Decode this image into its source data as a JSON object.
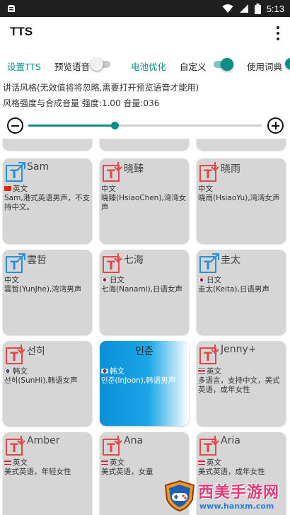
{
  "status_bar": {
    "time": "5:13",
    "icons": [
      "notification-icon",
      "wifi-icon",
      "signal-icon",
      "battery-icon"
    ]
  },
  "app_bar": {
    "title": "TTS",
    "menu_icon": "overflow-menu-icon"
  },
  "tabs": [
    {
      "label": "设置TTS",
      "active": true
    },
    {
      "label": "预览语音",
      "switch_on": false
    },
    {
      "label": "电池优化",
      "active": true
    },
    {
      "label": "自定义",
      "switch_on": true
    },
    {
      "label": "使用词典"
    }
  ],
  "info": {
    "speaking_style": "讲话风格(无效值将将忽略,需要打开预览语音才能用)",
    "style_strength": "风格强度与合成音量  强度:1.00 音量:036"
  },
  "slider": {
    "value_fraction": 0.37,
    "minus_icon": "minus-circle-icon",
    "plus_icon": "plus-circle-icon"
  },
  "colors": {
    "accent": "#0a8f86",
    "male_icon": "#2a8fd6",
    "female_icon": "#e04848",
    "selected_card": "#0a8fd6",
    "card_bg": "#d6d6d6"
  },
  "voices": [
    {
      "name": "",
      "gender": "female",
      "partial": true
    },
    {
      "name": "",
      "gender": "female",
      "partial": true
    },
    {
      "name": "",
      "gender": "female",
      "partial": true
    },
    {
      "name": "Sam",
      "gender": "male",
      "flag": "hk",
      "lang": "英文",
      "desc": "Sam,港式英语男声，不支持中文。"
    },
    {
      "name": "晓臻",
      "gender": "female",
      "lang": "中文",
      "desc": "晓臻(HsiaoChen),湾湾女声"
    },
    {
      "name": "晓雨",
      "gender": "female",
      "lang": "中文",
      "desc": "晓雨(HsiaoYu),湾湾女声"
    },
    {
      "name": "雲哲",
      "gender": "male",
      "lang": "中文",
      "desc": "雲哲(YunJhe),湾湾男声"
    },
    {
      "name": "七海",
      "gender": "female",
      "flag": "jp",
      "lang": "日文",
      "desc": "七海(Nanami),日语女声"
    },
    {
      "name": "圭太",
      "gender": "male",
      "flag": "jp",
      "lang": "日文",
      "desc": "圭太(Keita),日语男声"
    },
    {
      "name": "선히",
      "gender": "female",
      "flag": "kr",
      "lang": "韩文",
      "desc": "선히(SunHi),韩语女声"
    },
    {
      "name": "인준",
      "gender": "male",
      "flag": "kr",
      "lang": "韩文",
      "desc": "인준(InJoon),韩语男声",
      "selected": true
    },
    {
      "name": "Jenny+",
      "gender": "female",
      "flag": "us",
      "lang": "英文",
      "desc": "多语言，支持中文，美式英语，成年女性"
    },
    {
      "name": "Amber",
      "gender": "female",
      "flag": "us",
      "lang": "英文",
      "desc": "美式英语，年轻女性"
    },
    {
      "name": "Ana",
      "gender": "female",
      "flag": "us",
      "lang": "英文",
      "desc": "美式英语，女童"
    },
    {
      "name": "Aria",
      "gender": "female",
      "flag": "us",
      "lang": "英文",
      "desc": "美式英语，成年女性"
    }
  ],
  "watermark": {
    "title": "西美手游网",
    "url": "www.hanxm.com"
  }
}
